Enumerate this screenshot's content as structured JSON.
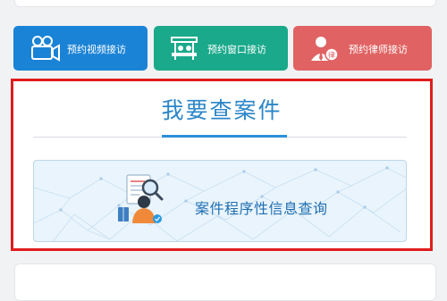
{
  "buttons": {
    "video": "预约视频接访",
    "window": "预约窗口接访",
    "lawyer": "预约律师接访"
  },
  "case_section": {
    "title": "我要查案件",
    "query_label": "案件程序性信息查询"
  },
  "icons": {
    "video": "video-camera-icon",
    "window": "service-window-icon",
    "lawyer": "lawyer-icon",
    "query": "magnifier-document-icon"
  },
  "colors": {
    "video_button": "#1a83d6",
    "window_button": "#1aa98b",
    "lawyer_button": "#e06262",
    "highlight_border": "#e01c1c",
    "title_blue": "#2b86c8"
  }
}
